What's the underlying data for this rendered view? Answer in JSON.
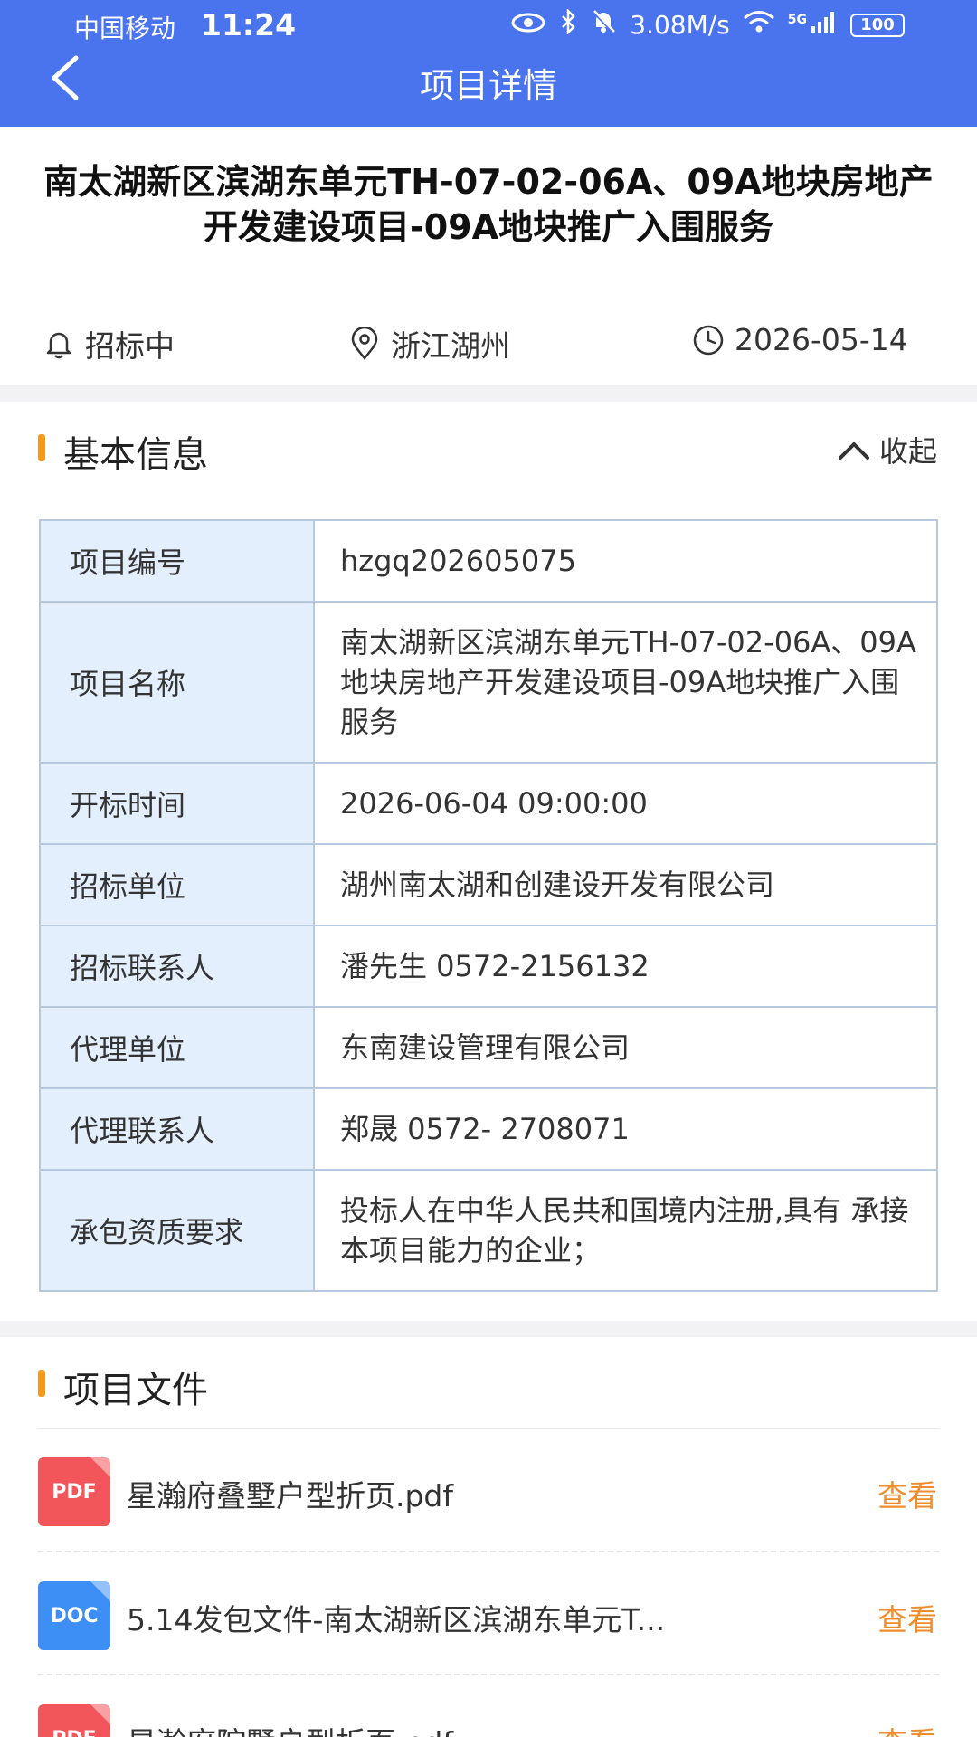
{
  "status_bar": {
    "carrier": "中国移动",
    "time": "11:24",
    "net_speed": "3.08M/s",
    "network": "5G",
    "battery": "100"
  },
  "nav": {
    "title": "项目详情"
  },
  "project": {
    "title": "南太湖新区滨湖东单元TH-07-02-06A、09A地块房地产开发建设项目-09A地块推广入围服务",
    "status": "招标中",
    "location": "浙江湖州",
    "date": "2026-05-14"
  },
  "basic_info": {
    "section_title": "基本信息",
    "collapse_label": "收起",
    "rows": [
      {
        "key": "项目编号",
        "value": "hzgq202605075"
      },
      {
        "key": "项目名称",
        "value": "南太湖新区滨湖东单元TH-07-02-06A、09A地块房地产开发建设项目-09A地块推广入围服务"
      },
      {
        "key": "开标时间",
        "value": "2026-06-04 09:00:00"
      },
      {
        "key": "招标单位",
        "value": "湖州南太湖和创建设开发有限公司"
      },
      {
        "key": "招标联系人",
        "value": "潘先生 0572-2156132"
      },
      {
        "key": "代理单位",
        "value": "东南建设管理有限公司"
      },
      {
        "key": "代理联系人",
        "value": "郑晟 0572- 2708071"
      },
      {
        "key": "承包资质要求",
        "value": "投标人在中华人民共和国境内注册,具有 承接本项目能力的企业；"
      }
    ]
  },
  "files": {
    "section_title": "项目文件",
    "items": [
      {
        "type": "PDF",
        "name": "星瀚府叠墅户型折页.pdf",
        "action": "查看"
      },
      {
        "type": "DOC",
        "name": "5.14发包文件-南太湖新区滨湖东单元T...",
        "action": "查看"
      },
      {
        "type": "PDF",
        "name": "星瀚府院墅户型折页.pdf",
        "action": "查看"
      }
    ]
  },
  "colors": {
    "header_bg": "#4a74ee",
    "accent_orange": "#f08c2a",
    "section_bar": "#f29a1e",
    "table_key_bg": "#e4effd",
    "pdf_icon": "#f2555a",
    "doc_icon": "#3d8ef5"
  }
}
